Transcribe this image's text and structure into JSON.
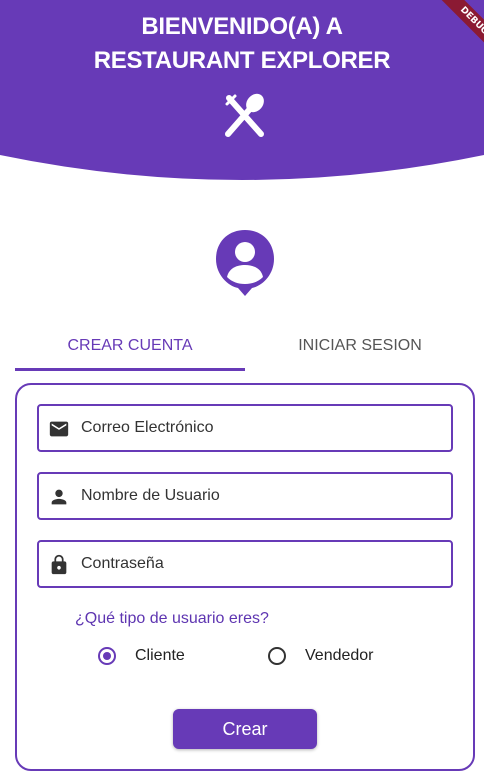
{
  "colors": {
    "primary": "#673ab7",
    "debug_ribbon": "#8b1a33"
  },
  "header": {
    "title_line1": "BIENVENIDO(A) A",
    "title_line2": "RESTAURANT EXPLORER",
    "icon": "cutlery-icon"
  },
  "debug_banner": "DEBUG",
  "avatar_icon": "person-pin-icon",
  "tabs": [
    {
      "label": "CREAR CUENTA",
      "active": true
    },
    {
      "label": "INICIAR SESION",
      "active": false
    }
  ],
  "form": {
    "email": {
      "placeholder": "Correo Electrónico",
      "icon": "mail-icon"
    },
    "username": {
      "placeholder": "Nombre de Usuario",
      "icon": "person-icon"
    },
    "password": {
      "placeholder": "Contraseña",
      "icon": "lock-icon"
    },
    "question": "¿Qué tipo de usuario eres?",
    "options": [
      {
        "label": "Cliente",
        "selected": true
      },
      {
        "label": "Vendedor",
        "selected": false
      }
    ],
    "submit_label": "Crear"
  }
}
